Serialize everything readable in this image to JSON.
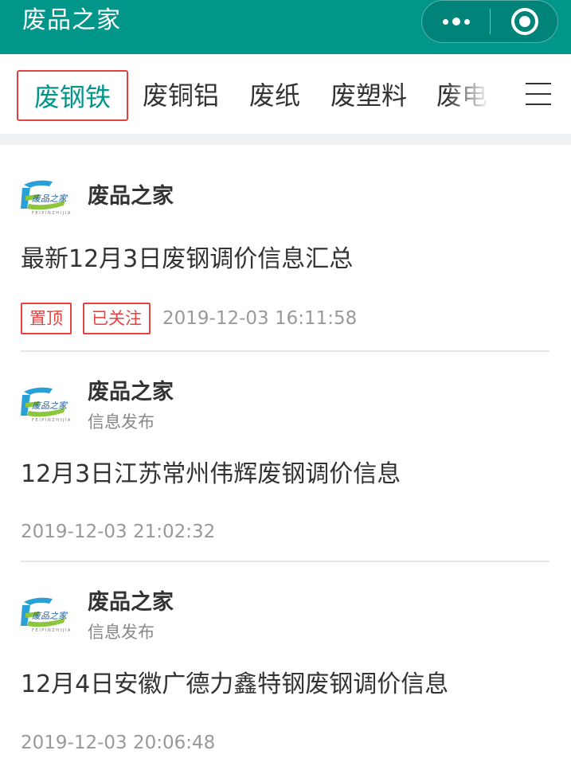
{
  "header": {
    "title": "废品之家",
    "more_icon": "more-dots-icon",
    "close_icon": "target-close-icon",
    "bg_color": "#00968a"
  },
  "tabs": [
    {
      "label": "废钢铁",
      "active": true
    },
    {
      "label": "废铜铝",
      "active": false
    },
    {
      "label": "废纸",
      "active": false
    },
    {
      "label": "废塑料",
      "active": false
    },
    {
      "label": "废电",
      "active": false
    }
  ],
  "menu_icon": "hamburger-menu-icon",
  "accent_red": "#e64340",
  "posts": [
    {
      "author": "废品之家",
      "subtitle": "",
      "title": "最新12月3日废钢调价信息汇总",
      "tags": [
        "置顶",
        "已关注"
      ],
      "time": "2019-12-03 16:11:58"
    },
    {
      "author": "废品之家",
      "subtitle": "信息发布",
      "title": "12月3日江苏常州伟辉废钢调价信息",
      "tags": [],
      "time": "2019-12-03 21:02:32"
    },
    {
      "author": "废品之家",
      "subtitle": "信息发布",
      "title": "12月4日安徽广德力鑫特钢废钢调价信息",
      "tags": [],
      "time": "2019-12-03 20:06:48"
    }
  ]
}
